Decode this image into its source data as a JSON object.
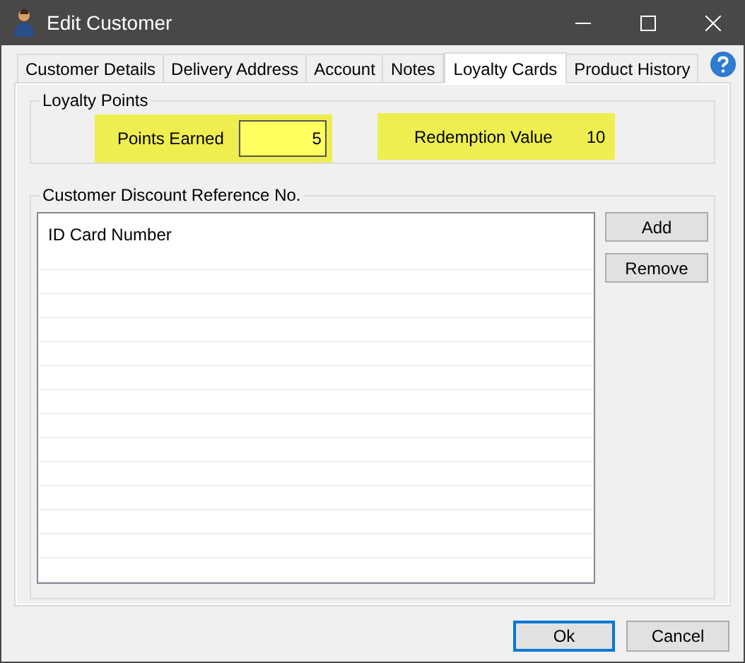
{
  "window": {
    "title": "Edit Customer"
  },
  "tabs": [
    {
      "label": "Customer Details",
      "selected": false
    },
    {
      "label": "Delivery Address",
      "selected": false
    },
    {
      "label": "Account",
      "selected": false
    },
    {
      "label": "Notes",
      "selected": false
    },
    {
      "label": "Loyalty Cards",
      "selected": true
    },
    {
      "label": "Product History",
      "selected": false
    }
  ],
  "loyalty_points": {
    "title": "Loyalty Points",
    "points_earned": {
      "label": "Points Earned",
      "value": "5"
    },
    "redemption": {
      "label": "Redemption Value",
      "value": "10"
    }
  },
  "discount_reference": {
    "title": "Customer Discount Reference No.",
    "column": "ID Card Number",
    "buttons": [
      "Add",
      "Remove"
    ]
  },
  "buttons": [
    {
      "label": "Ok",
      "selected": true
    },
    {
      "label": "Cancel",
      "selected": false
    }
  ]
}
